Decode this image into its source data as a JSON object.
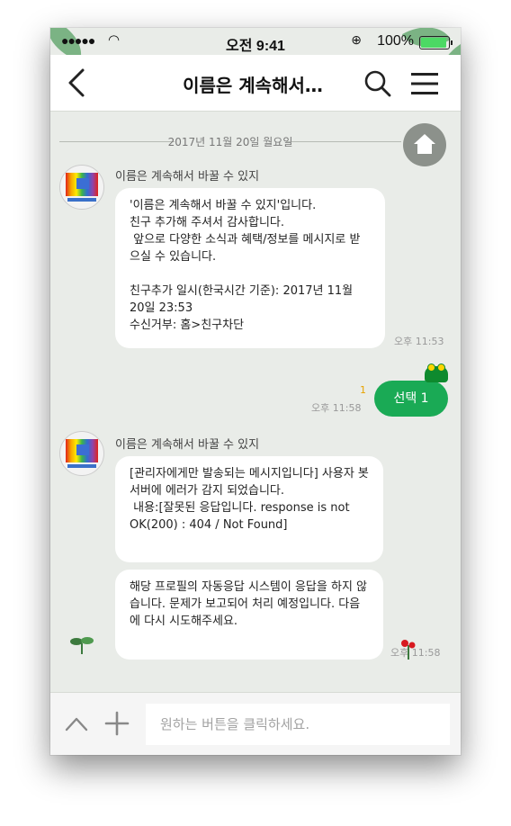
{
  "status_bar": {
    "time": "오전 9:41",
    "battery": "100%",
    "carrier": "●●●●●"
  },
  "header": {
    "title": "이름은 계속해서…"
  },
  "chat": {
    "date_separator": "2017년 11월 20일 월요일",
    "messages": [
      {
        "sender": "이름은 계속해서 바꿀 수 있지",
        "text": "'이름은 계속해서 바꿀 수 있지'입니다.\n친구 추가해 주셔서 감사합니다.\n 앞으로 다양한 소식과 혜택/정보를 메시지로 받으실 수 있습니다.\n\n친구추가 일시(한국시간 기준): 2017년 11월 20일 23:53\n수신거부: 홈>친구차단",
        "time": "오후 11:53"
      },
      {
        "mine": true,
        "text": "선택 1",
        "read_count": "1",
        "time": "오후 11:58"
      },
      {
        "sender": "이름은 계속해서 바꿀 수 있지",
        "bubbles": [
          "[관리자에게만 발송되는 메시지입니다] 사용자 봇서버에 에러가 감지 되었습니다.\n 내용:[잘못된 응답입니다. response is not OK(200) : 404 / Not Found]",
          "해당 프로필의 자동응답 시스템이 응답을 하지 않습니다. 문제가 보고되어 처리 예정입니다. 다음에 다시 시도해주세요."
        ],
        "time": "오후 11:58"
      }
    ]
  },
  "input": {
    "placeholder": "원하는 버튼을 클릭하세요."
  },
  "colors": {
    "accent": "#1aaa55",
    "background": "#e9ece8",
    "bubble": "#ffffff"
  }
}
